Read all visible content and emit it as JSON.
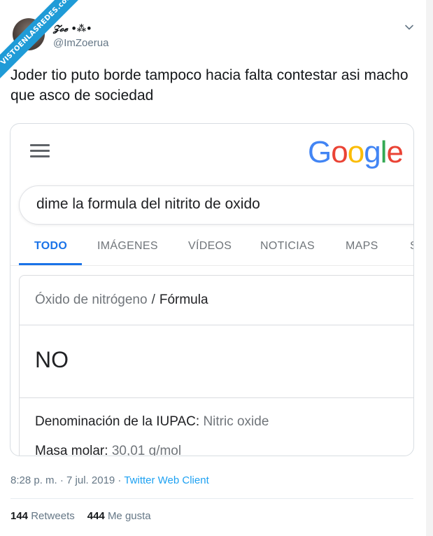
{
  "watermark": {
    "text": "VISTOENLASREDES.com"
  },
  "tweet": {
    "display_name": "𝓩𝓸𝓮 •⁂•",
    "handle": "@ImZoerua",
    "text": "Joder tio puto borde tampoco hacia falta contestar asi macho que asco de sociedad",
    "timestamp": "8:28 p. m. · 7 jul. 2019 · ",
    "client": "Twitter Web Client",
    "retweets_count": "144",
    "retweets_label": "Retweets",
    "likes_count": "444",
    "likes_label": "Me gusta"
  },
  "google": {
    "logo_letters": [
      "G",
      "o",
      "o",
      "g",
      "l",
      "e"
    ],
    "logo_colors": [
      "#4285F4",
      "#EA4335",
      "#FBBC05",
      "#4285F4",
      "#34A853",
      "#EA4335"
    ],
    "search_value": "dime la formula del nitrito de oxido",
    "tabs": [
      "TODO",
      "IMÁGENES",
      "VÍDEOS",
      "NOTICIAS",
      "MAPS",
      "S"
    ],
    "active_tab": "TODO",
    "knowledge_panel": {
      "breadcrumb_parent": "Óxido de nitrógeno",
      "breadcrumb_separator": "/",
      "breadcrumb_current": "Fórmula",
      "answer": "NO",
      "iupac_label": "Denominación de la IUPAC:",
      "iupac_value": "Nitric oxide",
      "molar_label": "Masa molar:",
      "molar_value": "30,01 g/mol"
    }
  },
  "colors": {
    "link_blue": "#1da1f2",
    "google_tab_blue": "#1a73e8",
    "watermark_blue": "#1f9bd7"
  }
}
